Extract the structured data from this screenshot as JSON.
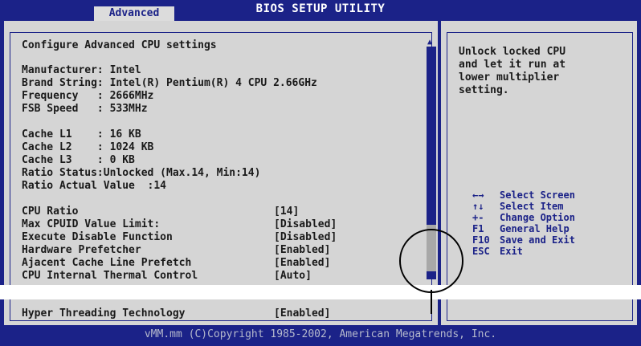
{
  "header": {
    "title": "BIOS SETUP UTILITY",
    "active_tab": "Advanced"
  },
  "main": {
    "section_title": "Configure Advanced CPU settings",
    "info_lines": [
      "Manufacturer: Intel",
      "Brand String: Intel(R) Pentium(R) 4 CPU 2.66GHz",
      "Frequency   : 2666MHz",
      "FSB Speed   : 533MHz",
      "Cache L1    : 16 KB",
      "Cache L2    : 1024 KB",
      "Cache L3    : 0 KB",
      "Ratio Status:Unlocked (Max.14, Min:14)",
      "Ratio Actual Value  :14"
    ],
    "settings": [
      {
        "label": "CPU Ratio",
        "value": "[14]"
      },
      {
        "label": "Max CPUID Value Limit:",
        "value": "[Disabled]"
      },
      {
        "label": "Execute Disable Function",
        "value": "[Disabled]"
      },
      {
        "label": "Hardware Prefetcher",
        "value": "[Enabled]"
      },
      {
        "label": "Ajacent Cache Line Prefetch",
        "value": "[Enabled]"
      },
      {
        "label": "CPU Internal Thermal Control",
        "value": "[Auto]"
      },
      {
        "label": "Hyper Threading Technology",
        "value": "[Enabled]"
      }
    ]
  },
  "help": {
    "lines": [
      "Unlock locked CPU",
      "and let it run at",
      "lower multiplier",
      "setting."
    ],
    "keys": [
      {
        "key": "←→",
        "action": "Select Screen"
      },
      {
        "key": "↑↓",
        "action": "Select Item"
      },
      {
        "key": "+-",
        "action": "Change Option"
      },
      {
        "key": "F1",
        "action": "General Help"
      },
      {
        "key": "F10",
        "action": "Save and Exit"
      },
      {
        "key": "ESC",
        "action": "Exit"
      }
    ]
  },
  "footer": {
    "copyright": "vMM.mm (C)Copyright 1985-2002, American Megatrends, Inc."
  },
  "colors": {
    "bios_blue": "#1b2288",
    "panel_gray": "#d5d5d5"
  }
}
